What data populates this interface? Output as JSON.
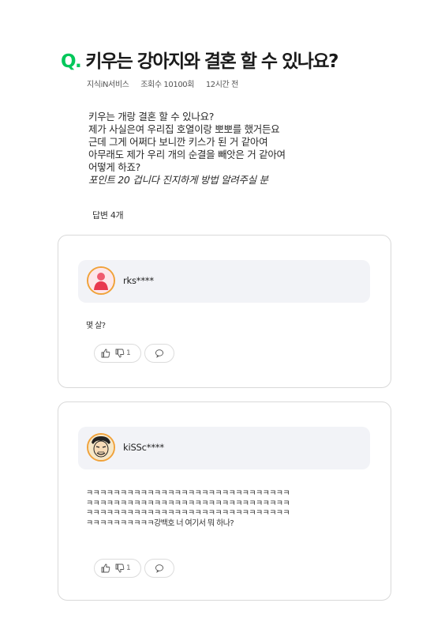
{
  "question": {
    "mark": "Q.",
    "title": "키우는 강아지와 결혼 할 수 있나요?",
    "meta": {
      "category": "지식iN서비스",
      "views": "조회수 10100회",
      "time": "12시간 전"
    },
    "body_lines": [
      "키우는 개랑 결혼 할 수 있나요?",
      "제가 사실은여 우리집 호열이랑 뽀뽀를 했거든요",
      "근데 그게 어쩌다 보니깐 키스가 된 거 같아여",
      "아무래도 제가 우리 개의 순결을 빼앗은 거 같아여",
      "어떻게 하죠?"
    ],
    "body_italic": "포인트 20 겁니다 진지하게 방법 알려주실 분"
  },
  "answers_count": "답변 4개",
  "answers": [
    {
      "username": "rks****",
      "avatar": "pink-person-avatar",
      "text_lines": [
        "몇 살?"
      ],
      "dislikes": "1"
    },
    {
      "username": "kiSSc****",
      "avatar": "cartoon-face-avatar",
      "text_lines": [
        "ㅋㅋㅋㅋㅋㅋㅋㅋㅋㅋㅋㅋㅋㅋㅋㅋㅋㅋㅋㅋㅋㅋㅋㅋㅋㅋㅋㅋㅋㅋ",
        "ㅋㅋㅋㅋㅋㅋㅋㅋㅋㅋㅋㅋㅋㅋㅋㅋㅋㅋㅋㅋㅋㅋㅋㅋㅋㅋㅋㅋㅋㅋ",
        "ㅋㅋㅋㅋㅋㅋㅋㅋㅋㅋㅋㅋㅋㅋㅋㅋㅋㅋㅋㅋㅋㅋㅋㅋㅋㅋㅋㅋㅋㅋ",
        "ㅋㅋㅋㅋㅋㅋㅋㅋㅋㅋ강백호 너 여기서 뭐 하나?"
      ],
      "dislikes": "1"
    }
  ],
  "colors": {
    "accent": "#03c75a",
    "avatar_ring": "#f0a23a",
    "user_bar": "#f2f3f7"
  }
}
